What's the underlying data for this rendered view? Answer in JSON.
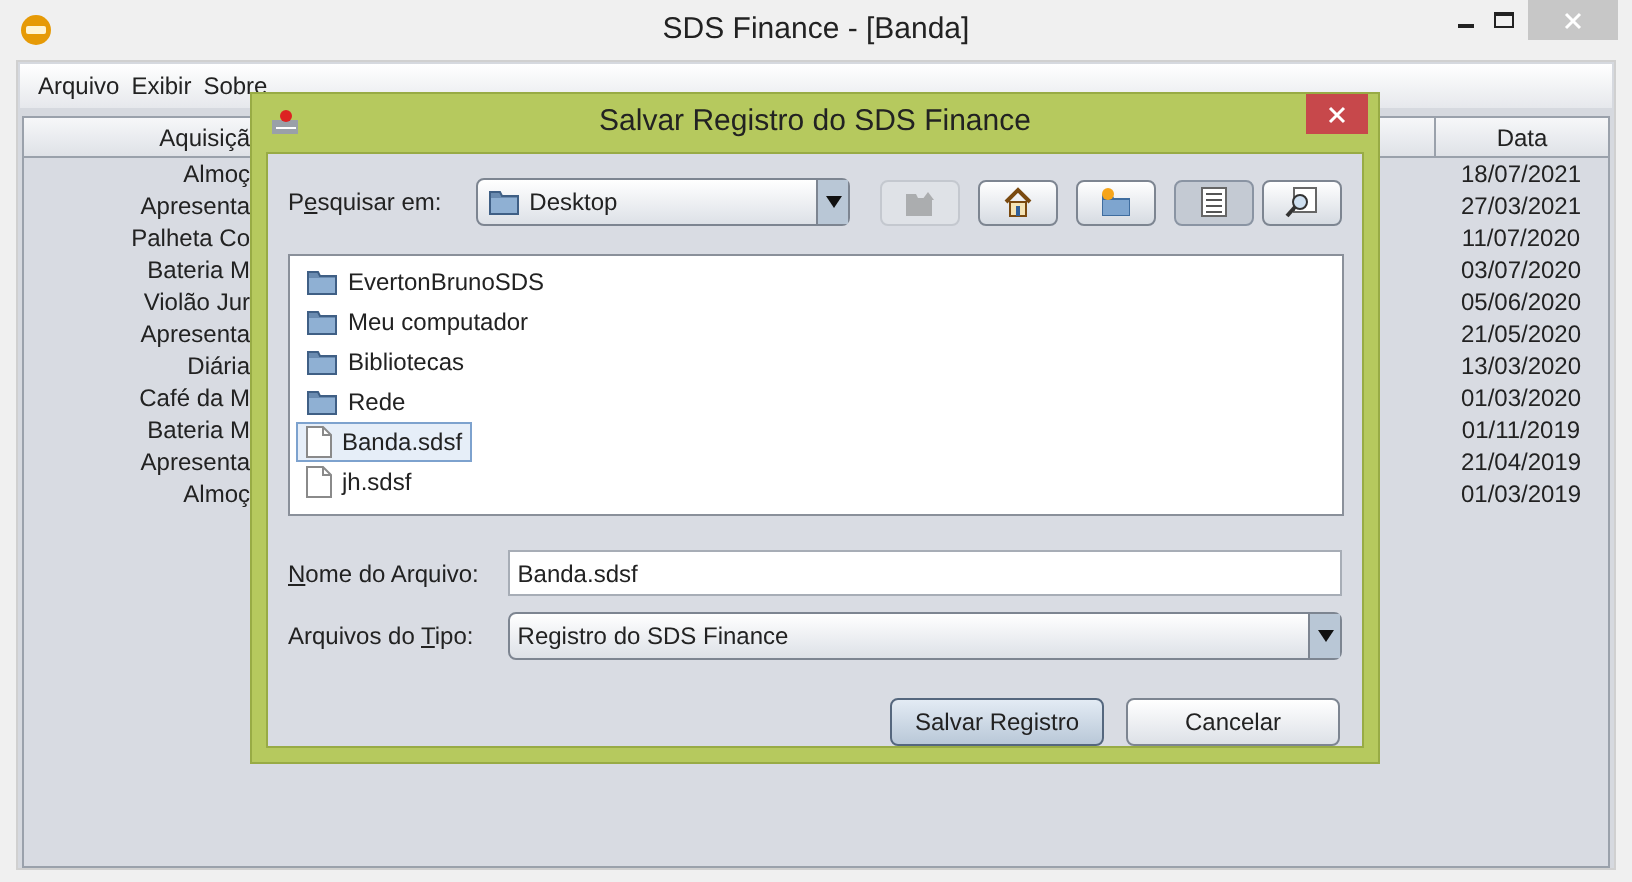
{
  "window": {
    "title": "SDS Finance - [Banda]"
  },
  "menu": [
    "Arquivo",
    "Exibir",
    "Sobre"
  ],
  "table": {
    "columns": [
      "Aquisiçã",
      "Data"
    ],
    "rows": [
      {
        "cells": [
          "Almoç",
          "18/07/2021"
        ]
      },
      {
        "cells": [
          "Apresenta",
          "27/03/2021"
        ]
      },
      {
        "cells": [
          "Palheta Co",
          "11/07/2020"
        ]
      },
      {
        "cells": [
          "Bateria M",
          "03/07/2020"
        ]
      },
      {
        "cells": [
          "Violão Jur",
          "05/06/2020"
        ]
      },
      {
        "cells": [
          "Apresenta",
          "21/05/2020"
        ]
      },
      {
        "cells": [
          "Diária",
          "13/03/2020"
        ]
      },
      {
        "cells": [
          "Café da M",
          "01/03/2020"
        ]
      },
      {
        "cells": [
          "Bateria M",
          "01/11/2019"
        ]
      },
      {
        "cells": [
          "Apresenta",
          "21/04/2019"
        ]
      },
      {
        "cells": [
          "Almoç",
          "01/03/2019"
        ]
      }
    ]
  },
  "dialog": {
    "title": "Salvar Registro do SDS Finance",
    "look_in": {
      "label": [
        {
          "text": "P",
          "underlined": false
        },
        {
          "text": "e",
          "underlined": true
        },
        {
          "text": "squisar em:",
          "underlined": false
        }
      ],
      "value": "Desktop"
    },
    "toolbar": [
      {
        "kind": "up",
        "disabled": true,
        "selected": false
      },
      {
        "kind": "home",
        "disabled": false,
        "selected": false
      },
      {
        "kind": "new-folder",
        "disabled": false,
        "selected": false
      },
      {
        "kind": "list",
        "disabled": false,
        "selected": true
      },
      {
        "kind": "details",
        "disabled": false,
        "selected": false
      }
    ],
    "files": [
      {
        "name": "EvertonBrunoSDS",
        "kind": "folder",
        "selected": false
      },
      {
        "name": "Meu computador",
        "kind": "folder",
        "selected": false
      },
      {
        "name": "Bibliotecas",
        "kind": "folder",
        "selected": false
      },
      {
        "name": "Rede",
        "kind": "folder",
        "selected": false
      },
      {
        "name": "Banda.sdsf",
        "kind": "file",
        "selected": true
      },
      {
        "name": "jh.sdsf",
        "kind": "file",
        "selected": false
      }
    ],
    "file_name": {
      "label": [
        {
          "text": "N",
          "underlined": true
        },
        {
          "text": "ome do Arquivo:",
          "underlined": false
        }
      ],
      "value": "Banda.sdsf"
    },
    "file_type": {
      "label": [
        {
          "text": "Arquivos do ",
          "underlined": false
        },
        {
          "text": "T",
          "underlined": true
        },
        {
          "text": "ipo:",
          "underlined": false
        }
      ],
      "value": "Registro do SDS Finance"
    },
    "buttons": [
      {
        "label": "Salvar Registro",
        "default": true
      },
      {
        "label": "Cancelar",
        "default": false
      }
    ]
  }
}
